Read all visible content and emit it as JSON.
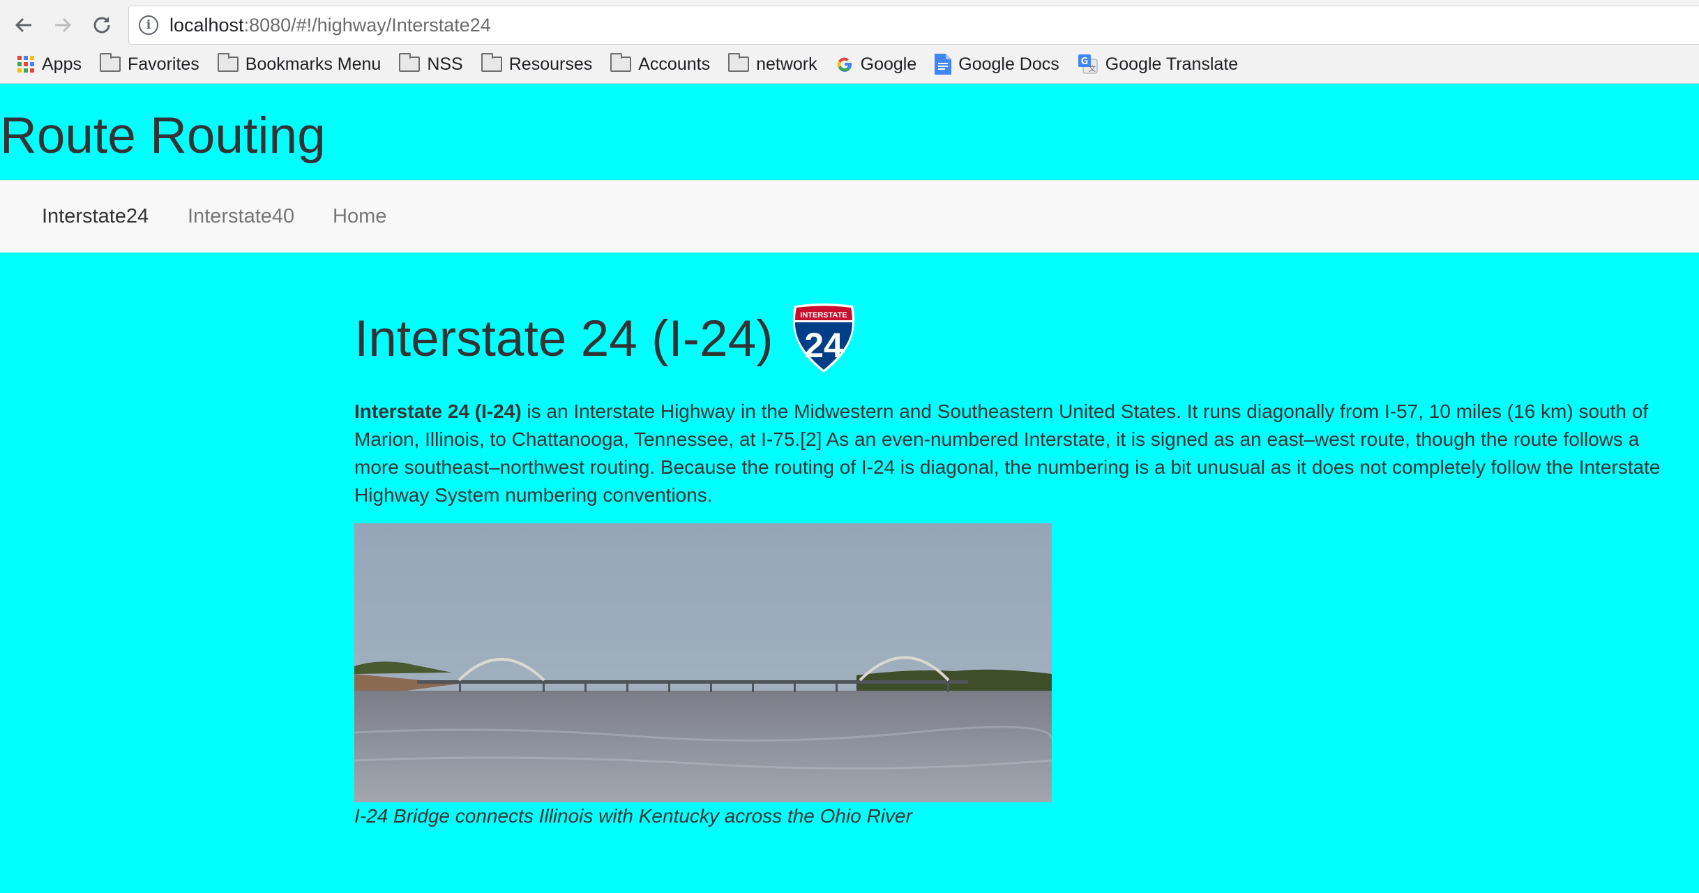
{
  "browser": {
    "url_host": "localhost",
    "url_rest": ":8080/#!/highway/Interstate24",
    "bookmarks": [
      {
        "label": "Apps",
        "icon": "apps-grid-icon"
      },
      {
        "label": "Favorites",
        "icon": "folder-icon"
      },
      {
        "label": "Bookmarks Menu",
        "icon": "folder-icon"
      },
      {
        "label": "NSS",
        "icon": "folder-icon"
      },
      {
        "label": "Resourses",
        "icon": "folder-icon"
      },
      {
        "label": "Accounts",
        "icon": "folder-icon"
      },
      {
        "label": "network",
        "icon": "folder-icon"
      },
      {
        "label": "Google",
        "icon": "google-g-icon"
      },
      {
        "label": "Google Docs",
        "icon": "google-docs-icon"
      },
      {
        "label": "Google Translate",
        "icon": "google-translate-icon"
      }
    ]
  },
  "site": {
    "title": "Route Routing",
    "nav": [
      "Interstate24",
      "Interstate40",
      "Home"
    ],
    "active_nav": "Interstate24"
  },
  "article": {
    "heading": "Interstate 24 (I-24)",
    "shield": {
      "top": "INTERSTATE",
      "number": "24"
    },
    "lead_bold": "Interstate 24 (I-24)",
    "body": " is an Interstate Highway in the Midwestern and Southeastern United States. It runs diagonally from I-57, 10 miles (16 km) south of Marion, Illinois, to Chattanooga, Tennessee, at I-75.[2] As an even-numbered Interstate, it is signed as an east–west route, though the route follows a more southeast–northwest routing. Because the routing of I-24 is diagonal, the numbering is a bit unusual as it does not completely follow the Interstate Highway System numbering conventions.",
    "caption": "I-24 Bridge connects Illinois with Kentucky across the Ohio River"
  },
  "colors": {
    "page_bg": "#00ffff",
    "navbar_bg": "#f8f8f8",
    "shield_red": "#c8102e",
    "shield_blue": "#003f87"
  }
}
